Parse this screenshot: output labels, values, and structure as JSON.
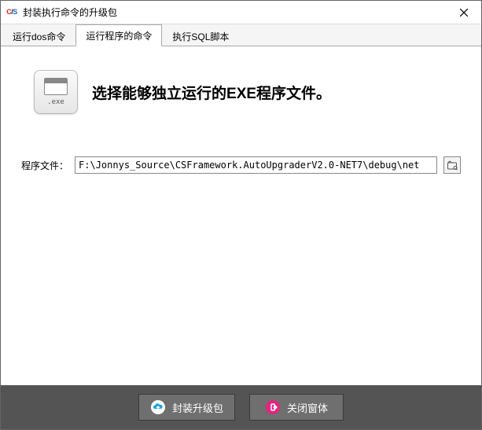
{
  "window": {
    "title": "封装执行命令的升级包"
  },
  "tabs": [
    {
      "label": "运行dos命令",
      "active": false
    },
    {
      "label": "运行程序的命令",
      "active": true
    },
    {
      "label": "执行SQL脚本",
      "active": false
    }
  ],
  "hero": {
    "icon_label": ".exe",
    "text_prefix": "选择能够独立运行的",
    "text_strong": "EXE",
    "text_suffix": "程序文件。"
  },
  "field": {
    "label": "程序文件：",
    "value": "F:\\Jonnys_Source\\CSFramework.AutoUpgraderV2.0-NET7\\debug\\net"
  },
  "footer": {
    "package_label": "封装升级包",
    "close_label": "关闭窗体"
  }
}
